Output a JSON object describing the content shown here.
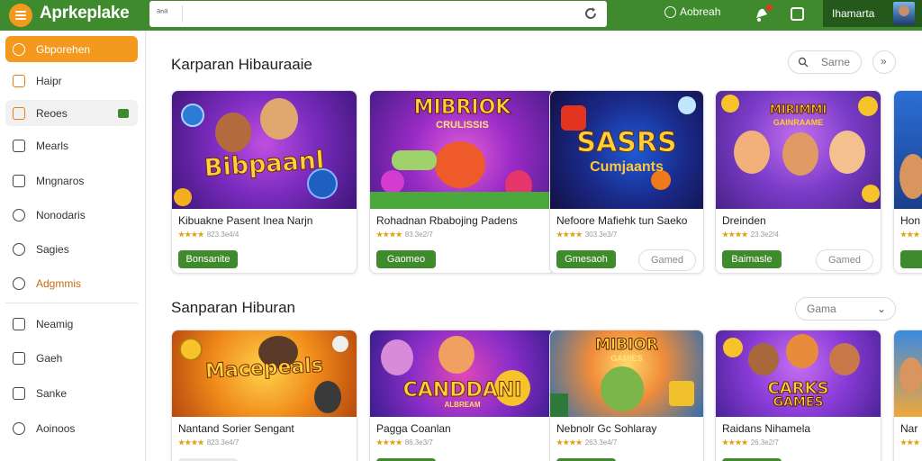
{
  "app": {
    "title": "Aprkeplake"
  },
  "topbar": {
    "search_tag": "ᵃⁿᵃ",
    "search_value": "",
    "account_label": "Aobreah",
    "user_name": "Ihamarta"
  },
  "sidebar": {
    "items": [
      {
        "label": "Gbporehen",
        "icon": "smile-icon"
      },
      {
        "label": "Haipr",
        "icon": "home-icon"
      },
      {
        "label": "Reoes",
        "icon": "briefcase-icon"
      },
      {
        "label": "Mearls",
        "icon": "chart-icon"
      },
      {
        "label": "Mngnaros",
        "icon": "image-icon"
      },
      {
        "label": "Nonodaris",
        "icon": "palette-icon"
      },
      {
        "label": "Sagies",
        "icon": "game-icon"
      },
      {
        "label": "Adgmmis",
        "icon": "compass-icon"
      },
      {
        "label": "Neamig",
        "icon": "list-icon"
      },
      {
        "label": "Gaeh",
        "icon": "shield-icon"
      },
      {
        "label": "Sanke",
        "icon": "box-icon"
      },
      {
        "label": "Aoinoos",
        "icon": "pin-icon"
      }
    ]
  },
  "section1": {
    "title": "Karparan Hibauraaie",
    "search_label": "Sarne",
    "cards": [
      {
        "thumb_title": "Bibpaanl",
        "title": "Kibuakne Pasent Inea Narjn",
        "rating": "★★★★",
        "meta": "823.3e4/4",
        "button": "Bonsanite"
      },
      {
        "thumb_title": "MIBRIOK",
        "thumb_sub": "CRULISSIS",
        "title": "Rohadnan Rbabojing Padens",
        "rating": "★★★★",
        "meta": "83.3e2/7",
        "button": "Gaomeo"
      },
      {
        "thumb_title": "SASRS",
        "thumb_sub": "Cumjaants",
        "title": "Nefoore Mafiehk tun Saeko",
        "rating": "★★★★",
        "meta": "303.3e3/7",
        "button": "Gmesaoh",
        "secondary": "Gamed"
      },
      {
        "thumb_title": "MIRIMMI",
        "thumb_sub": "GAINRAAME",
        "title": "Dreinden",
        "rating": "★★★★",
        "meta": "23.3e2/4",
        "button": "Baimasle",
        "secondary": "Gamed"
      },
      {
        "title": "Hon",
        "rating": "★★★",
        "meta": "",
        "button": ""
      }
    ]
  },
  "section2": {
    "title": "Sanparan Hiburan",
    "filter_label": "Gama",
    "cards": [
      {
        "thumb_title": "Macepeals",
        "title": "Nantand Sorier Sengant",
        "rating": "★★★★",
        "meta": "823.3e4/7"
      },
      {
        "thumb_title": "CANDDANI",
        "thumb_sub": "ALBREAM",
        "title": "Pagga Coanlan",
        "rating": "★★★★",
        "meta": "86.3e3/7"
      },
      {
        "thumb_title": "MIBIOR",
        "thumb_sub": "GAMIES",
        "title": "Nebnolr Gc Sohlaray",
        "rating": "★★★★",
        "meta": "263.3e4/7"
      },
      {
        "thumb_title": "CARKS",
        "thumb_sub": "GAMES",
        "title": "Raidans Nihamela",
        "rating": "★★★★",
        "meta": "26.3e2/7"
      },
      {
        "title": "Nar",
        "rating": "★★★",
        "meta": ""
      }
    ]
  },
  "colors": {
    "green": "#3f8a2c",
    "orange": "#f39a1e"
  }
}
